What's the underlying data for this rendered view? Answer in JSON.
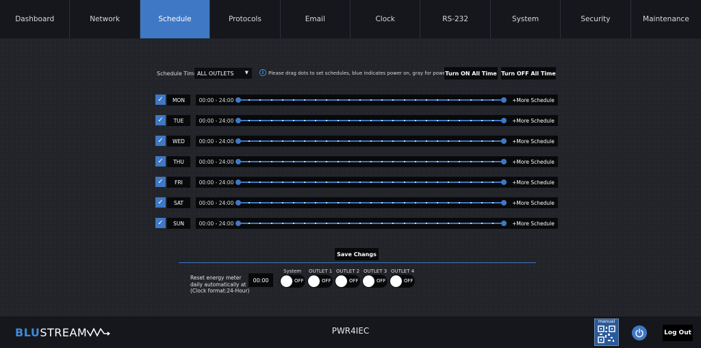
{
  "nav": {
    "tabs": [
      "Dashboard",
      "Network",
      "Schedule",
      "Protocols",
      "Email",
      "Clock",
      "RS-232",
      "System",
      "Security",
      "Maintenance"
    ],
    "active": "Schedule"
  },
  "schedule": {
    "timer_label": "Schedule Timer:",
    "timer_value": "ALL OUTLETS",
    "hint": "Please drag dots to set schedules, blue indicates power on, gray for power off",
    "turn_on_all": "Turn ON All Time",
    "turn_off_all": "Turn OFF All Time",
    "days": [
      {
        "day": "MON",
        "range": "00:00 - 24:00",
        "checked": true
      },
      {
        "day": "TUE",
        "range": "00:00 - 24:00",
        "checked": true
      },
      {
        "day": "WED",
        "range": "00:00 - 24:00",
        "checked": true
      },
      {
        "day": "THU",
        "range": "00:00 - 24:00",
        "checked": true
      },
      {
        "day": "FRI",
        "range": "00:00 - 24:00",
        "checked": true
      },
      {
        "day": "SAT",
        "range": "00:00 - 24:00",
        "checked": true
      },
      {
        "day": "SUN",
        "range": "00:00 - 24:00",
        "checked": true
      }
    ],
    "more_label": "+More Schedule",
    "save_label": "Save Changs"
  },
  "energy": {
    "line1": "Reset energy meter",
    "line2": "daily automatically at",
    "line3": "(Clock format:24-Hour)",
    "time": "00:00",
    "toggles": [
      {
        "label": "System",
        "state": "OFF"
      },
      {
        "label": "OUTLET 1",
        "state": "OFF"
      },
      {
        "label": "OUTLET 2",
        "state": "OFF"
      },
      {
        "label": "OUTLET 3",
        "state": "OFF"
      },
      {
        "label": "OUTLET 4",
        "state": "OFF"
      }
    ]
  },
  "footer": {
    "logo_blu": "BLU",
    "logo_stream": "STREAM",
    "model": "PWR4IEC",
    "manual_label": "manual",
    "logout_label": "Log Out"
  },
  "colors": {
    "accent": "#3f78c4",
    "background": "#22242a",
    "bar": "#15171c"
  }
}
